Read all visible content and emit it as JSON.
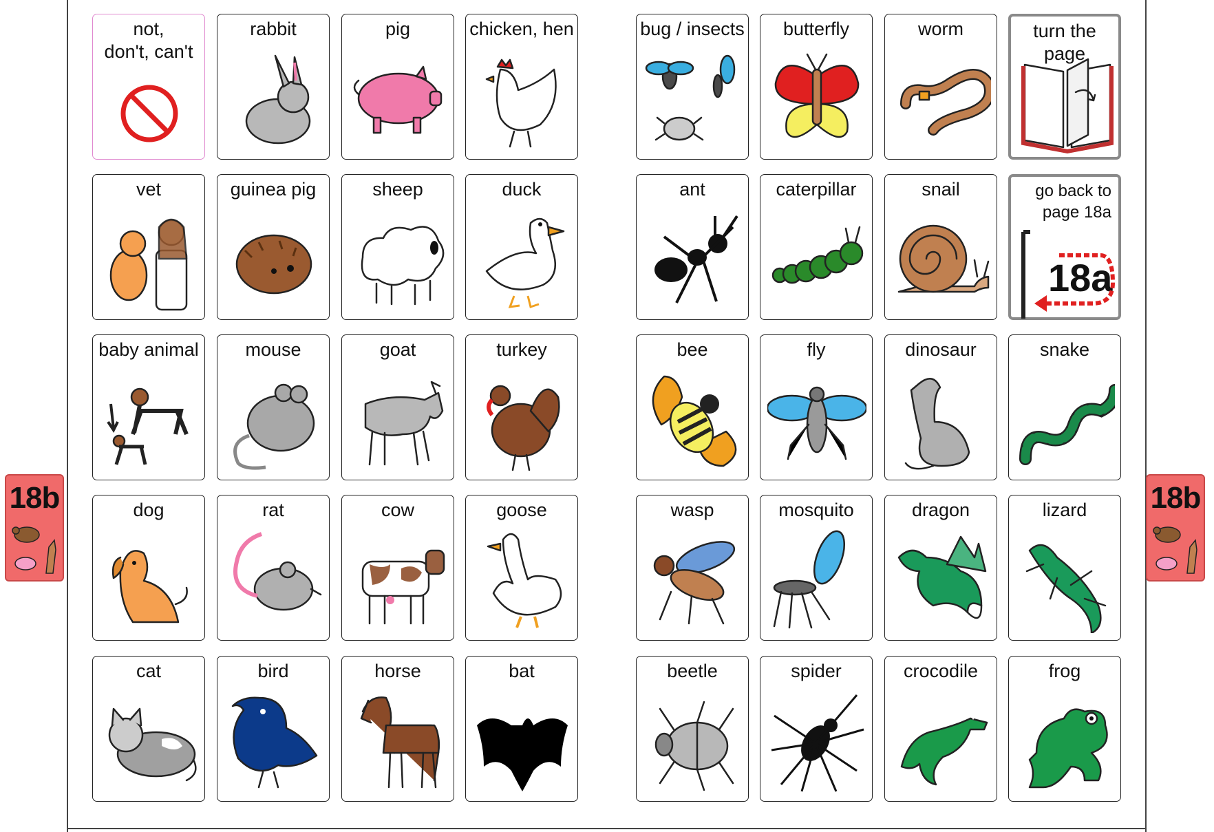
{
  "page_tab": {
    "label": "18b"
  },
  "left_grid": [
    [
      {
        "label": "not,\ndon't, can't",
        "icon": "no-symbol-icon",
        "color": "#e02020"
      },
      {
        "label": "rabbit",
        "icon": "rabbit-icon",
        "color": "#b8b8b8"
      },
      {
        "label": "pig",
        "icon": "pig-icon",
        "color": "#f07aaa"
      },
      {
        "label": "chicken,  hen",
        "icon": "hen-icon",
        "color": "#ffffff"
      }
    ],
    [
      {
        "label": "vet",
        "icon": "vet-icon",
        "color": "#f5a050"
      },
      {
        "label": "guinea pig",
        "icon": "guinea-pig-icon",
        "color": "#9a5a30"
      },
      {
        "label": "sheep",
        "icon": "sheep-icon",
        "color": "#ffffff"
      },
      {
        "label": "duck",
        "icon": "duck-icon",
        "color": "#ffffff"
      }
    ],
    [
      {
        "label": "baby animal",
        "icon": "baby-animal-icon",
        "color": "#222222"
      },
      {
        "label": "mouse",
        "icon": "mouse-icon",
        "color": "#a8a8a8"
      },
      {
        "label": "goat",
        "icon": "goat-icon",
        "color": "#b8b8b8"
      },
      {
        "label": "turkey",
        "icon": "turkey-icon",
        "color": "#8a4a28"
      }
    ],
    [
      {
        "label": "dog",
        "icon": "dog-icon",
        "color": "#f5a050"
      },
      {
        "label": "rat",
        "icon": "rat-icon",
        "color": "#b0b0b0"
      },
      {
        "label": "cow",
        "icon": "cow-icon",
        "color": "#9a6040"
      },
      {
        "label": "goose",
        "icon": "goose-icon",
        "color": "#ffffff"
      }
    ],
    [
      {
        "label": "cat",
        "icon": "cat-icon",
        "color": "#a0a0a0"
      },
      {
        "label": "bird",
        "icon": "bird-icon",
        "color": "#0c3a8a"
      },
      {
        "label": "horse",
        "icon": "horse-icon",
        "color": "#8a4a28"
      },
      {
        "label": "bat",
        "icon": "bat-icon",
        "color": "#000000"
      }
    ]
  ],
  "right_grid": [
    [
      {
        "label": "bug / insects",
        "icon": "insects-icon",
        "color": "#3aaee0"
      },
      {
        "label": "butterfly",
        "icon": "butterfly-icon",
        "color": "#e02020"
      },
      {
        "label": "worm",
        "icon": "worm-icon",
        "color": "#c08050"
      },
      {
        "label": "turn the page",
        "icon": "book-icon",
        "color": "#c03030"
      }
    ],
    [
      {
        "label": "ant",
        "icon": "ant-icon",
        "color": "#111111"
      },
      {
        "label": "caterpillar",
        "icon": "caterpillar-icon",
        "color": "#2a8a2a"
      },
      {
        "label": "snail",
        "icon": "snail-icon",
        "color": "#c08050"
      },
      {
        "label": "go back to\npage 18a",
        "icon": "back-arrow-icon",
        "color": "#e02020",
        "sub": "18a"
      }
    ],
    [
      {
        "label": "bee",
        "icon": "bee-icon",
        "color": "#f0a020"
      },
      {
        "label": "fly",
        "icon": "fly-icon",
        "color": "#4ab4e8"
      },
      {
        "label": "dinosaur",
        "icon": "dinosaur-icon",
        "color": "#b0b0b0"
      },
      {
        "label": "snake",
        "icon": "snake-icon",
        "color": "#1a8a4a"
      }
    ],
    [
      {
        "label": "wasp",
        "icon": "wasp-icon",
        "color": "#c08050"
      },
      {
        "label": "mosquito",
        "icon": "mosquito-icon",
        "color": "#4ab4e8"
      },
      {
        "label": "dragon",
        "icon": "dragon-icon",
        "color": "#1a9a5a"
      },
      {
        "label": "lizard",
        "icon": "lizard-icon",
        "color": "#1a9a5a"
      }
    ],
    [
      {
        "label": "beetle",
        "icon": "beetle-icon",
        "color": "#b8b8b8"
      },
      {
        "label": "spider",
        "icon": "spider-icon",
        "color": "#111111"
      },
      {
        "label": "crocodile",
        "icon": "crocodile-icon",
        "color": "#1a9a4a"
      },
      {
        "label": "frog",
        "icon": "frog-icon",
        "color": "#1a9a4a"
      }
    ]
  ]
}
